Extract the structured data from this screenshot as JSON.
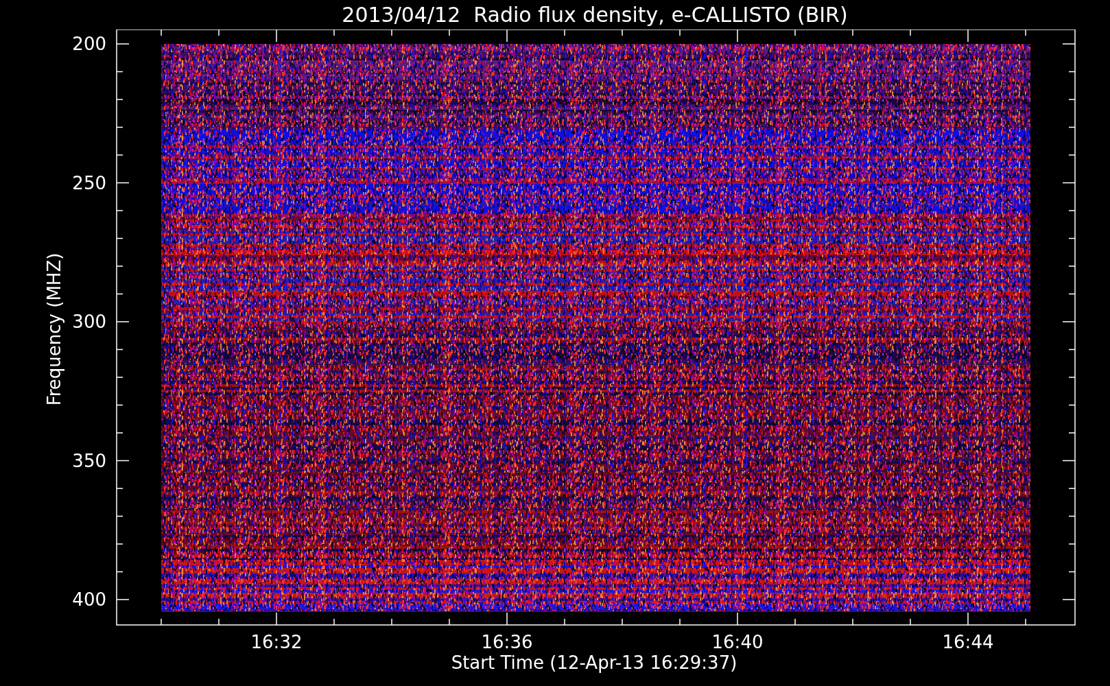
{
  "title": "2013/04/12  Radio flux density, e-CALLISTO (BIR)",
  "y_axis": {
    "label": "Frequency (MHZ)",
    "ticks": [
      "200",
      "250",
      "300",
      "350",
      "400"
    ]
  },
  "x_axis": {
    "label": "Start Time (12-Apr-13 16:29:37)",
    "ticks": [
      "16:32",
      "16:36",
      "16:40",
      "16:44"
    ]
  }
}
